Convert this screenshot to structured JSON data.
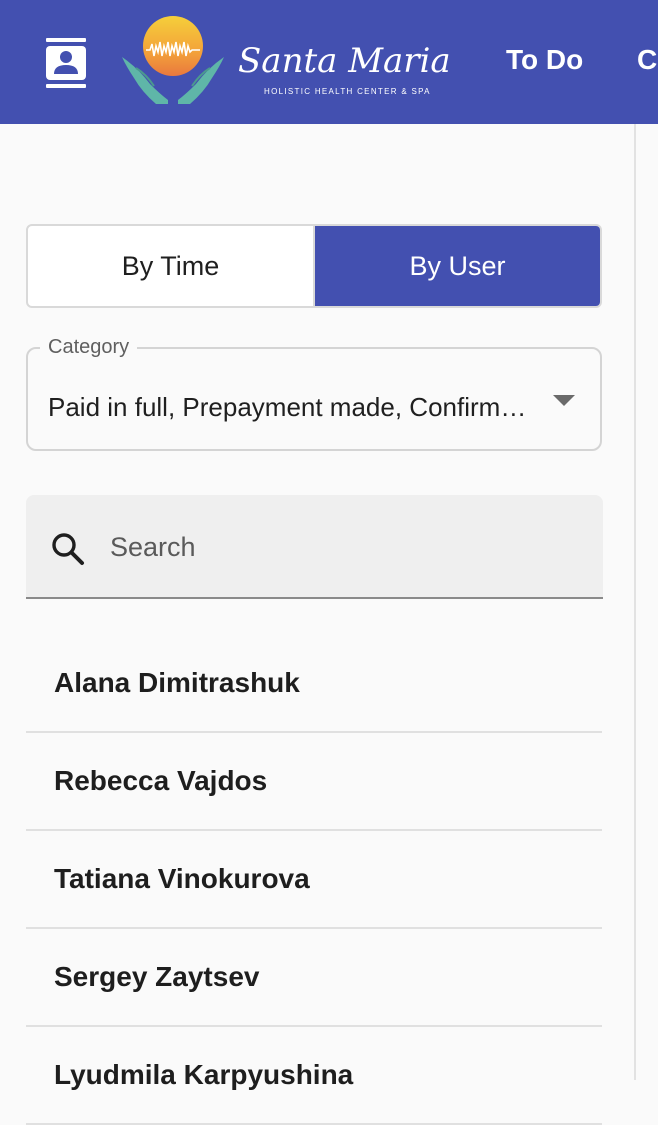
{
  "header": {
    "logo": {
      "name": "Santa Maria",
      "tagline": "HOLISTIC HEALTH CENTER & SPA"
    },
    "nav": [
      {
        "label": "To Do"
      },
      {
        "label": "Ca"
      }
    ],
    "contacts_icon": "contacts-icon",
    "brand_color": "#4350b0"
  },
  "view_toggle": {
    "options": [
      {
        "label": "By Time",
        "active": false
      },
      {
        "label": "By User",
        "active": true
      }
    ]
  },
  "category": {
    "label": "Category",
    "value": "Paid in full, Prepayment made, Confirmed",
    "icon": "chevron-down-icon"
  },
  "search": {
    "placeholder": "Search",
    "value": "",
    "icon": "search-icon"
  },
  "users": [
    {
      "name": "Alana Dimitrashuk"
    },
    {
      "name": "Rebecca Vajdos"
    },
    {
      "name": "Tatiana Vinokurova"
    },
    {
      "name": "Sergey Zaytsev"
    },
    {
      "name": "Lyudmila Karpyushina"
    }
  ]
}
